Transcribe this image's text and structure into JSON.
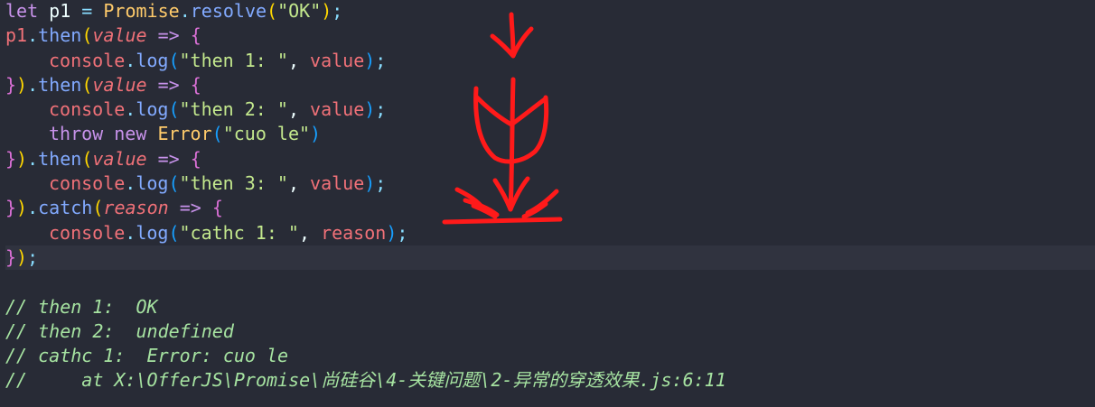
{
  "code_lines": [
    {
      "tokens": [
        {
          "t": "let",
          "c": "kw"
        },
        {
          "t": " ",
          "c": "plain"
        },
        {
          "t": "p1",
          "c": "var"
        },
        {
          "t": " = ",
          "c": "op"
        },
        {
          "t": "Promise",
          "c": "cls"
        },
        {
          "t": ".",
          "c": "punct"
        },
        {
          "t": "resolve",
          "c": "fn"
        },
        {
          "t": "(",
          "c": "br1"
        },
        {
          "t": "\"OK\"",
          "c": "str"
        },
        {
          "t": ")",
          "c": "br1"
        },
        {
          "t": ";",
          "c": "punct"
        }
      ]
    },
    {
      "tokens": [
        {
          "t": "p1",
          "c": "ident"
        },
        {
          "t": ".",
          "c": "punct"
        },
        {
          "t": "then",
          "c": "fn"
        },
        {
          "t": "(",
          "c": "br1"
        },
        {
          "t": "value",
          "c": "param"
        },
        {
          "t": " => ",
          "c": "kw"
        },
        {
          "t": "{",
          "c": "br2"
        }
      ]
    },
    {
      "indent": 1,
      "tokens": [
        {
          "t": "console",
          "c": "ident"
        },
        {
          "t": ".",
          "c": "punct"
        },
        {
          "t": "log",
          "c": "fn"
        },
        {
          "t": "(",
          "c": "br3"
        },
        {
          "t": "\"then 1: \"",
          "c": "str"
        },
        {
          "t": ", ",
          "c": "plain"
        },
        {
          "t": "value",
          "c": "ident"
        },
        {
          "t": ")",
          "c": "br3"
        },
        {
          "t": ";",
          "c": "punct"
        }
      ]
    },
    {
      "tokens": [
        {
          "t": "}",
          "c": "br2"
        },
        {
          "t": ")",
          "c": "br1"
        },
        {
          "t": ".",
          "c": "punct"
        },
        {
          "t": "then",
          "c": "fn"
        },
        {
          "t": "(",
          "c": "br1"
        },
        {
          "t": "value",
          "c": "param"
        },
        {
          "t": " => ",
          "c": "kw"
        },
        {
          "t": "{",
          "c": "br2"
        }
      ]
    },
    {
      "indent": 1,
      "tokens": [
        {
          "t": "console",
          "c": "ident"
        },
        {
          "t": ".",
          "c": "punct"
        },
        {
          "t": "log",
          "c": "fn"
        },
        {
          "t": "(",
          "c": "br3"
        },
        {
          "t": "\"then 2: \"",
          "c": "str"
        },
        {
          "t": ", ",
          "c": "plain"
        },
        {
          "t": "value",
          "c": "ident"
        },
        {
          "t": ")",
          "c": "br3"
        },
        {
          "t": ";",
          "c": "punct"
        }
      ]
    },
    {
      "indent": 1,
      "tokens": [
        {
          "t": "throw",
          "c": "kw"
        },
        {
          "t": " ",
          "c": "plain"
        },
        {
          "t": "new",
          "c": "kw"
        },
        {
          "t": " ",
          "c": "plain"
        },
        {
          "t": "Error",
          "c": "cls"
        },
        {
          "t": "(",
          "c": "br3"
        },
        {
          "t": "\"cuo le\"",
          "c": "str"
        },
        {
          "t": ")",
          "c": "br3"
        }
      ]
    },
    {
      "tokens": [
        {
          "t": "}",
          "c": "br2"
        },
        {
          "t": ")",
          "c": "br1"
        },
        {
          "t": ".",
          "c": "punct"
        },
        {
          "t": "then",
          "c": "fn"
        },
        {
          "t": "(",
          "c": "br1"
        },
        {
          "t": "value",
          "c": "param"
        },
        {
          "t": " => ",
          "c": "kw"
        },
        {
          "t": "{",
          "c": "br2"
        }
      ]
    },
    {
      "indent": 1,
      "tokens": [
        {
          "t": "console",
          "c": "ident"
        },
        {
          "t": ".",
          "c": "punct"
        },
        {
          "t": "log",
          "c": "fn"
        },
        {
          "t": "(",
          "c": "br3"
        },
        {
          "t": "\"then 3: \"",
          "c": "str"
        },
        {
          "t": ", ",
          "c": "plain"
        },
        {
          "t": "value",
          "c": "ident"
        },
        {
          "t": ")",
          "c": "br3"
        },
        {
          "t": ";",
          "c": "punct"
        }
      ]
    },
    {
      "tokens": [
        {
          "t": "}",
          "c": "br2"
        },
        {
          "t": ")",
          "c": "br1"
        },
        {
          "t": ".",
          "c": "punct"
        },
        {
          "t": "catch",
          "c": "fn"
        },
        {
          "t": "(",
          "c": "br1"
        },
        {
          "t": "reason",
          "c": "param"
        },
        {
          "t": " => ",
          "c": "kw"
        },
        {
          "t": "{",
          "c": "br2"
        }
      ]
    },
    {
      "indent": 1,
      "tokens": [
        {
          "t": "console",
          "c": "ident"
        },
        {
          "t": ".",
          "c": "punct"
        },
        {
          "t": "log",
          "c": "fn"
        },
        {
          "t": "(",
          "c": "br3"
        },
        {
          "t": "\"cathc 1: \"",
          "c": "str"
        },
        {
          "t": ", ",
          "c": "plain"
        },
        {
          "t": "reason",
          "c": "ident"
        },
        {
          "t": ")",
          "c": "br3"
        },
        {
          "t": ";",
          "c": "punct"
        }
      ]
    },
    {
      "current": true,
      "tokens": [
        {
          "t": "}",
          "c": "br2"
        },
        {
          "t": ")",
          "c": "br1"
        },
        {
          "t": ";",
          "c": "punct"
        }
      ]
    },
    {
      "tokens": []
    },
    {
      "tokens": [
        {
          "t": "// then 1:  OK",
          "c": "comment"
        }
      ]
    },
    {
      "tokens": [
        {
          "t": "// then 2:  undefined",
          "c": "comment"
        }
      ]
    },
    {
      "tokens": [
        {
          "t": "// cathc 1:  Error: cuo le",
          "c": "comment"
        }
      ]
    },
    {
      "tokens": [
        {
          "t": "//     at X:\\OfferJS\\Promise\\尚硅谷\\4-关键问题\\2-异常的穿透效果.js:6:11",
          "c": "comment"
        }
      ]
    }
  ],
  "colors": {
    "background": "#282b36",
    "current_line": "#30333f",
    "sketch_ink": "#ff1a1a"
  },
  "icons": {
    "sketch": "hand-drawn-falling-arrow-icon"
  }
}
